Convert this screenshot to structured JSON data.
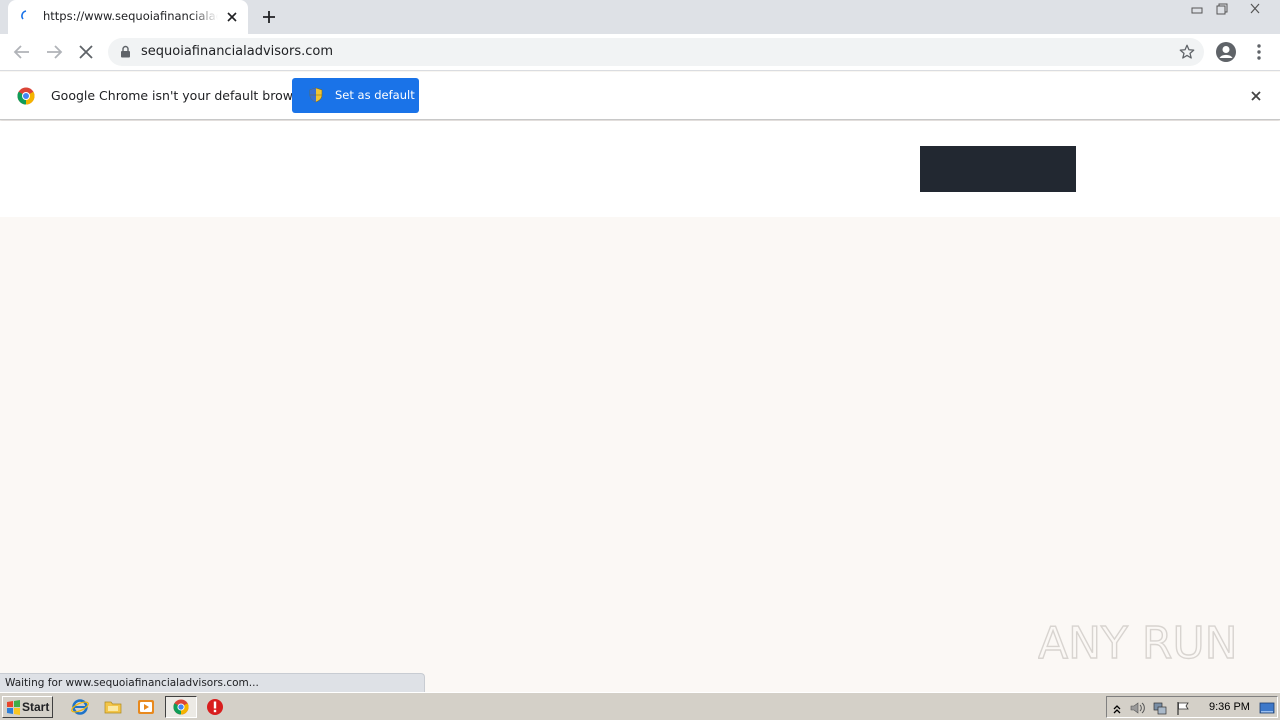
{
  "browser": {
    "tab": {
      "title": "https://www.sequoiafinancialadvisors.com"
    },
    "address_bar": {
      "url": "sequoiafinancialadvisors.com"
    }
  },
  "infobar": {
    "message": "Google Chrome isn't your default browser",
    "button_label": "Set as default"
  },
  "status": {
    "text": "Waiting for www.sequoiafinancialadvisors.com..."
  },
  "watermark": {
    "text": "ANY RUN"
  },
  "taskbar": {
    "start_label": "Start",
    "clock": "9:36 PM"
  },
  "colors": {
    "accent": "#1a73e8",
    "header_block": "#222831",
    "page_background": "#fbf8f5"
  }
}
